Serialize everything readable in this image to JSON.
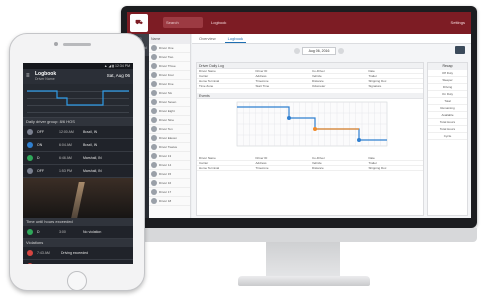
{
  "phone": {
    "status_text": "▲ ◢ ▮ 12:34 PM",
    "header_title": "Logbook",
    "header_sub": "Driver Name",
    "header_date": "Sat, Aug 06",
    "section_drive": "Daily driver group: 8/6 HOS",
    "section_hos": "Time until hours exceeded",
    "section_violations": "Violations",
    "rows": [
      {
        "status": "OFF",
        "time": "12:00 AM",
        "loc": "Brazil, IN",
        "color": "#7b8190"
      },
      {
        "status": "ON",
        "time": "6:04 AM",
        "loc": "Brazil, IN",
        "color": "#2f7fd0"
      },
      {
        "status": "D",
        "time": "6:46 AM",
        "loc": "Marshall, IN",
        "color": "#2fa85a"
      },
      {
        "status": "OFF",
        "time": "1:53 PM",
        "loc": "Marshall, IN",
        "color": "#7b8190"
      }
    ],
    "hos_row": {
      "status": "D",
      "time": "3:00",
      "loc": "No violation"
    },
    "violations": [
      {
        "time": "7:43 AM",
        "text": "Driving exceeded"
      },
      {
        "time": "7:43 AM",
        "text": "Missing break"
      },
      {
        "time": "7:43 AM",
        "text": "On-duty limit"
      }
    ]
  },
  "desktop": {
    "topbar_search": "Search",
    "topbar_title": "Logbook",
    "topbar_settings": "Settings",
    "nav_items": [
      "Dashboard",
      "Fleet",
      "Drivers",
      "Logs",
      "Reports",
      "Settings"
    ],
    "drivers_header": "Name",
    "drivers": [
      "Driver One",
      "Driver Two",
      "Driver Three",
      "Driver Four",
      "Driver Five",
      "Driver Six",
      "Driver Seven",
      "Driver Eight",
      "Driver Nine",
      "Driver Ten",
      "Driver Eleven",
      "Driver Twelve",
      "Driver 13",
      "Driver 14",
      "Driver 15",
      "Driver 16",
      "Driver 17",
      "Driver 18"
    ],
    "tab_overview": "Overview",
    "tab_logbook": "Logbook",
    "date_value": "Aug 06, 2016",
    "section_log": "Driver Daily Log",
    "grid_rows": [
      [
        "Driver Name",
        "Driver ID",
        "Co-Driver",
        "Date"
      ],
      [
        "Carrier",
        "Address",
        "Vehicle",
        "Trailer"
      ],
      [
        "Home Terminal",
        "Timezone",
        "Distance",
        "Shipping Doc"
      ],
      [
        "Time Zone",
        "Start Time",
        "Odometer",
        "Signature"
      ]
    ],
    "section_events": "Events",
    "right_panel_header": "Recap",
    "right_panel_rows": [
      "Off Duty",
      "Sleeper",
      "Driving",
      "On Duty",
      "Total",
      "Remaining",
      "Available",
      "Total Hours",
      "Total Hours",
      "Cycle"
    ]
  }
}
